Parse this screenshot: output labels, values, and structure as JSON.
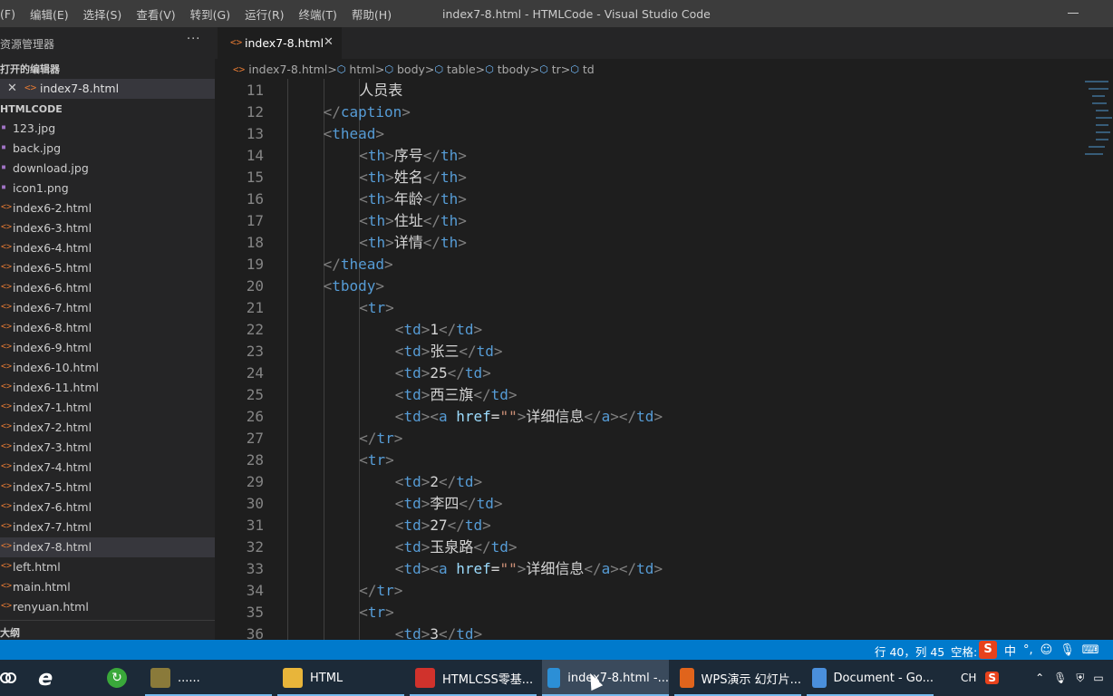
{
  "menu": [
    "(F)",
    "编辑(E)",
    "选择(S)",
    "查看(V)",
    "转到(G)",
    "运行(R)",
    "终端(T)",
    "帮助(H)"
  ],
  "window_title": "index7-8.html - HTMLCode - Visual Studio Code",
  "sidebar": {
    "title": "资源管理器",
    "more": "···",
    "open_editors_label": "打开的编辑器",
    "open_editor_file": "index7-8.html",
    "folder_label": "HTMLCODE",
    "files": [
      {
        "name": "123.jpg",
        "kind": "img"
      },
      {
        "name": "back.jpg",
        "kind": "img"
      },
      {
        "name": "download.jpg",
        "kind": "img"
      },
      {
        "name": "icon1.png",
        "kind": "img"
      },
      {
        "name": "index6-2.html",
        "kind": "html"
      },
      {
        "name": "index6-3.html",
        "kind": "html"
      },
      {
        "name": "index6-4.html",
        "kind": "html"
      },
      {
        "name": "index6-5.html",
        "kind": "html"
      },
      {
        "name": "index6-6.html",
        "kind": "html"
      },
      {
        "name": "index6-7.html",
        "kind": "html"
      },
      {
        "name": "index6-8.html",
        "kind": "html"
      },
      {
        "name": "index6-9.html",
        "kind": "html"
      },
      {
        "name": "index6-10.html",
        "kind": "html"
      },
      {
        "name": "index6-11.html",
        "kind": "html"
      },
      {
        "name": "index7-1.html",
        "kind": "html"
      },
      {
        "name": "index7-2.html",
        "kind": "html"
      },
      {
        "name": "index7-3.html",
        "kind": "html"
      },
      {
        "name": "index7-4.html",
        "kind": "html"
      },
      {
        "name": "index7-5.html",
        "kind": "html"
      },
      {
        "name": "index7-6.html",
        "kind": "html"
      },
      {
        "name": "index7-7.html",
        "kind": "html"
      },
      {
        "name": "index7-8.html",
        "kind": "html",
        "active": true
      },
      {
        "name": "left.html",
        "kind": "html"
      },
      {
        "name": "main.html",
        "kind": "html"
      },
      {
        "name": "renyuan.html",
        "kind": "html"
      }
    ],
    "outline_label": "大纲"
  },
  "tab": {
    "label": "index7-8.html",
    "close": "✕"
  },
  "breadcrumb": [
    "index7-8.html",
    "html",
    "body",
    "table",
    "tbody",
    "tr",
    "td"
  ],
  "code": [
    {
      "n": "11",
      "indent": 3,
      "tokens": [
        [
          "t",
          "人员表"
        ]
      ]
    },
    {
      "n": "12",
      "indent": 2,
      "tokens": [
        [
          "b",
          "</"
        ],
        [
          "g",
          "caption"
        ],
        [
          "b",
          ">"
        ]
      ]
    },
    {
      "n": "13",
      "indent": 2,
      "tokens": [
        [
          "b",
          "<"
        ],
        [
          "g",
          "thead"
        ],
        [
          "b",
          ">"
        ]
      ]
    },
    {
      "n": "14",
      "indent": 3,
      "tokens": [
        [
          "b",
          "<"
        ],
        [
          "g",
          "th"
        ],
        [
          "b",
          ">"
        ],
        [
          "t",
          "序号"
        ],
        [
          "b",
          "</"
        ],
        [
          "g",
          "th"
        ],
        [
          "b",
          ">"
        ]
      ]
    },
    {
      "n": "15",
      "indent": 3,
      "tokens": [
        [
          "b",
          "<"
        ],
        [
          "g",
          "th"
        ],
        [
          "b",
          ">"
        ],
        [
          "t",
          "姓名"
        ],
        [
          "b",
          "</"
        ],
        [
          "g",
          "th"
        ],
        [
          "b",
          ">"
        ]
      ]
    },
    {
      "n": "16",
      "indent": 3,
      "tokens": [
        [
          "b",
          "<"
        ],
        [
          "g",
          "th"
        ],
        [
          "b",
          ">"
        ],
        [
          "t",
          "年龄"
        ],
        [
          "b",
          "</"
        ],
        [
          "g",
          "th"
        ],
        [
          "b",
          ">"
        ]
      ]
    },
    {
      "n": "17",
      "indent": 3,
      "tokens": [
        [
          "b",
          "<"
        ],
        [
          "g",
          "th"
        ],
        [
          "b",
          ">"
        ],
        [
          "t",
          "住址"
        ],
        [
          "b",
          "</"
        ],
        [
          "g",
          "th"
        ],
        [
          "b",
          ">"
        ]
      ]
    },
    {
      "n": "18",
      "indent": 3,
      "tokens": [
        [
          "b",
          "<"
        ],
        [
          "g",
          "th"
        ],
        [
          "b",
          ">"
        ],
        [
          "t",
          "详情"
        ],
        [
          "b",
          "</"
        ],
        [
          "g",
          "th"
        ],
        [
          "b",
          ">"
        ]
      ]
    },
    {
      "n": "19",
      "indent": 2,
      "tokens": [
        [
          "b",
          "</"
        ],
        [
          "g",
          "thead"
        ],
        [
          "b",
          ">"
        ]
      ]
    },
    {
      "n": "20",
      "indent": 2,
      "tokens": [
        [
          "b",
          "<"
        ],
        [
          "g",
          "tbody"
        ],
        [
          "b",
          ">"
        ]
      ]
    },
    {
      "n": "21",
      "indent": 3,
      "tokens": [
        [
          "b",
          "<"
        ],
        [
          "g",
          "tr"
        ],
        [
          "b",
          ">"
        ]
      ]
    },
    {
      "n": "22",
      "indent": 4,
      "tokens": [
        [
          "b",
          "<"
        ],
        [
          "g",
          "td"
        ],
        [
          "b",
          ">"
        ],
        [
          "t",
          "1"
        ],
        [
          "b",
          "</"
        ],
        [
          "g",
          "td"
        ],
        [
          "b",
          ">"
        ]
      ]
    },
    {
      "n": "23",
      "indent": 4,
      "tokens": [
        [
          "b",
          "<"
        ],
        [
          "g",
          "td"
        ],
        [
          "b",
          ">"
        ],
        [
          "t",
          "张三"
        ],
        [
          "b",
          "</"
        ],
        [
          "g",
          "td"
        ],
        [
          "b",
          ">"
        ]
      ]
    },
    {
      "n": "24",
      "indent": 4,
      "tokens": [
        [
          "b",
          "<"
        ],
        [
          "g",
          "td"
        ],
        [
          "b",
          ">"
        ],
        [
          "t",
          "25"
        ],
        [
          "b",
          "</"
        ],
        [
          "g",
          "td"
        ],
        [
          "b",
          ">"
        ]
      ]
    },
    {
      "n": "25",
      "indent": 4,
      "tokens": [
        [
          "b",
          "<"
        ],
        [
          "g",
          "td"
        ],
        [
          "b",
          ">"
        ],
        [
          "t",
          "西三旗"
        ],
        [
          "b",
          "</"
        ],
        [
          "g",
          "td"
        ],
        [
          "b",
          ">"
        ]
      ]
    },
    {
      "n": "26",
      "indent": 4,
      "tokens": [
        [
          "b",
          "<"
        ],
        [
          "g",
          "td"
        ],
        [
          "b",
          ">"
        ],
        [
          "b",
          "<"
        ],
        [
          "g",
          "a"
        ],
        [
          "t",
          " "
        ],
        [
          "a",
          "href"
        ],
        [
          "t",
          "="
        ],
        [
          "s",
          "\"\""
        ],
        [
          "b",
          ">"
        ],
        [
          "t",
          "详细信息"
        ],
        [
          "b",
          "</"
        ],
        [
          "g",
          "a"
        ],
        [
          "b",
          "></"
        ],
        [
          "g",
          "td"
        ],
        [
          "b",
          ">"
        ]
      ]
    },
    {
      "n": "27",
      "indent": 3,
      "tokens": [
        [
          "b",
          "</"
        ],
        [
          "g",
          "tr"
        ],
        [
          "b",
          ">"
        ]
      ]
    },
    {
      "n": "28",
      "indent": 3,
      "tokens": [
        [
          "b",
          "<"
        ],
        [
          "g",
          "tr"
        ],
        [
          "b",
          ">"
        ]
      ]
    },
    {
      "n": "29",
      "indent": 4,
      "tokens": [
        [
          "b",
          "<"
        ],
        [
          "g",
          "td"
        ],
        [
          "b",
          ">"
        ],
        [
          "t",
          "2"
        ],
        [
          "b",
          "</"
        ],
        [
          "g",
          "td"
        ],
        [
          "b",
          ">"
        ]
      ]
    },
    {
      "n": "30",
      "indent": 4,
      "tokens": [
        [
          "b",
          "<"
        ],
        [
          "g",
          "td"
        ],
        [
          "b",
          ">"
        ],
        [
          "t",
          "李四"
        ],
        [
          "b",
          "</"
        ],
        [
          "g",
          "td"
        ],
        [
          "b",
          ">"
        ]
      ]
    },
    {
      "n": "31",
      "indent": 4,
      "tokens": [
        [
          "b",
          "<"
        ],
        [
          "g",
          "td"
        ],
        [
          "b",
          ">"
        ],
        [
          "t",
          "27"
        ],
        [
          "b",
          "</"
        ],
        [
          "g",
          "td"
        ],
        [
          "b",
          ">"
        ]
      ]
    },
    {
      "n": "32",
      "indent": 4,
      "tokens": [
        [
          "b",
          "<"
        ],
        [
          "g",
          "td"
        ],
        [
          "b",
          ">"
        ],
        [
          "t",
          "玉泉路"
        ],
        [
          "b",
          "</"
        ],
        [
          "g",
          "td"
        ],
        [
          "b",
          ">"
        ]
      ]
    },
    {
      "n": "33",
      "indent": 4,
      "tokens": [
        [
          "b",
          "<"
        ],
        [
          "g",
          "td"
        ],
        [
          "b",
          ">"
        ],
        [
          "b",
          "<"
        ],
        [
          "g",
          "a"
        ],
        [
          "t",
          " "
        ],
        [
          "a",
          "href"
        ],
        [
          "t",
          "="
        ],
        [
          "s",
          "\"\""
        ],
        [
          "b",
          ">"
        ],
        [
          "t",
          "详细信息"
        ],
        [
          "b",
          "</"
        ],
        [
          "g",
          "a"
        ],
        [
          "b",
          "></"
        ],
        [
          "g",
          "td"
        ],
        [
          "b",
          ">"
        ]
      ]
    },
    {
      "n": "34",
      "indent": 3,
      "tokens": [
        [
          "b",
          "</"
        ],
        [
          "g",
          "tr"
        ],
        [
          "b",
          ">"
        ]
      ]
    },
    {
      "n": "35",
      "indent": 3,
      "tokens": [
        [
          "b",
          "<"
        ],
        [
          "g",
          "tr"
        ],
        [
          "b",
          ">"
        ]
      ]
    },
    {
      "n": "36",
      "indent": 4,
      "tokens": [
        [
          "b",
          "<"
        ],
        [
          "g",
          "td"
        ],
        [
          "b",
          ">"
        ],
        [
          "t",
          "3"
        ],
        [
          "b",
          "</"
        ],
        [
          "g",
          "td"
        ],
        [
          "b",
          ">"
        ]
      ]
    }
  ],
  "status": {
    "position": "行 40，列 45",
    "indent": "空格:",
    "ime_items": [
      "中",
      "°,",
      "☺",
      "🎙",
      "⌨"
    ]
  },
  "taskbar": {
    "items": [
      {
        "label": "......",
        "icon": "snail-icon",
        "color": "#8a7a3a"
      },
      {
        "label": "HTML",
        "icon": "folder-icon",
        "color": "#e8b53a"
      },
      {
        "label": "HTMLCSS零基...",
        "icon": "wps-icon",
        "color": "#d0322c"
      },
      {
        "label": "index7-8.html -...",
        "icon": "vscode-icon",
        "color": "#2c8fd6",
        "active": true
      },
      {
        "label": "WPS演示 幻灯片...",
        "icon": "wps-present-icon",
        "color": "#e0641c"
      },
      {
        "label": "Document - Go...",
        "icon": "chrome-icon",
        "color": "#4a8fdc"
      }
    ],
    "tray_lang": "CH",
    "tray_sogou": "S"
  }
}
